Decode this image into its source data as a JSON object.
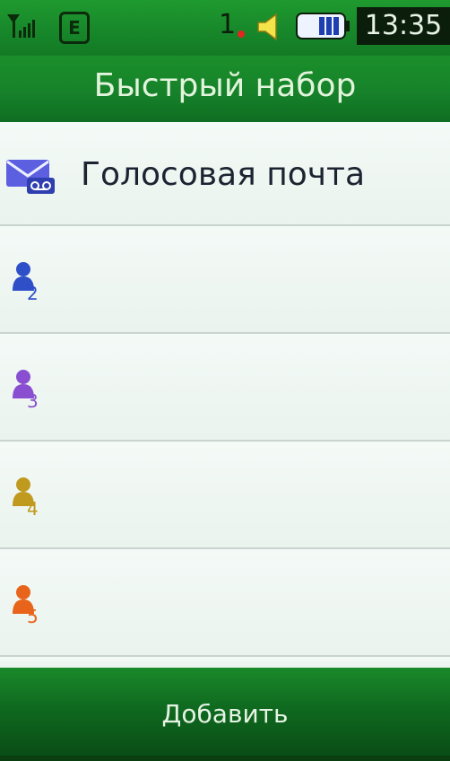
{
  "status_bar": {
    "network_type": "E",
    "sim_slot": "1",
    "time": "13:35"
  },
  "header": {
    "title": "Быстрый набор"
  },
  "speed_dial": {
    "items": [
      {
        "slot": "1",
        "label": "Голосовая почта",
        "icon": "voicemail-icon",
        "color": "#4a4fd8"
      },
      {
        "slot": "2",
        "label": "",
        "icon": "contact-icon",
        "color": "#2f4fc9"
      },
      {
        "slot": "3",
        "label": "",
        "icon": "contact-icon",
        "color": "#8a4fd0"
      },
      {
        "slot": "4",
        "label": "",
        "icon": "contact-icon",
        "color": "#c09a1e"
      },
      {
        "slot": "5",
        "label": "",
        "icon": "contact-icon",
        "color": "#e8641a"
      }
    ]
  },
  "footer": {
    "add_label": "Добавить"
  }
}
